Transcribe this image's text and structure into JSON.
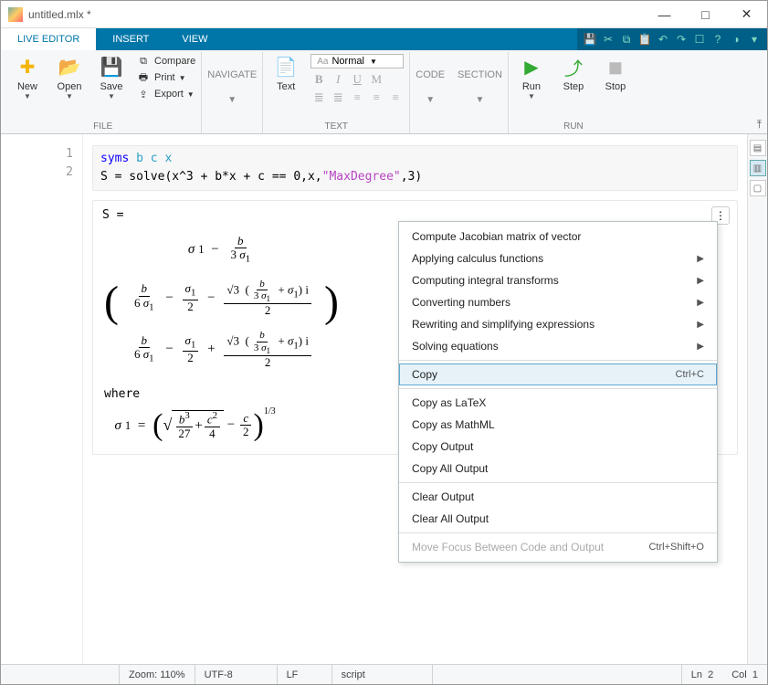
{
  "window": {
    "title": "untitled.mlx *"
  },
  "tabs": {
    "live_editor": "LIVE EDITOR",
    "insert": "INSERT",
    "view": "VIEW"
  },
  "ribbon": {
    "file": {
      "new": "New",
      "open": "Open",
      "save": "Save",
      "compare": "Compare",
      "print": "Print",
      "export": "Export",
      "label": "FILE"
    },
    "navigate": {
      "btn": "NAVIGATE"
    },
    "text": {
      "label": "TEXT",
      "btn": "Text",
      "style": "Normal"
    },
    "code": {
      "code": "CODE",
      "section": "SECTION"
    },
    "run": {
      "run": "Run",
      "step": "Step",
      "stop": "Stop",
      "label": "RUN"
    }
  },
  "lines": {
    "l1": "1",
    "l2": "2"
  },
  "code": {
    "kw": "syms",
    "vars": "b c x",
    "line2a": "S = solve(x^3 + b*x + c == 0,x,",
    "line2s": "\"MaxDegree\"",
    "line2b": ",3)"
  },
  "output": {
    "header": "S =",
    "where": "where"
  },
  "menu": {
    "jacobian": "Compute Jacobian matrix of vector",
    "calculus": "Applying calculus functions",
    "integral": "Computing integral transforms",
    "convert": "Converting numbers",
    "rewrite": "Rewriting and simplifying expressions",
    "solving": "Solving equations",
    "copy": "Copy",
    "copy_sc": "Ctrl+C",
    "copy_latex": "Copy as LaTeX",
    "copy_mathml": "Copy as MathML",
    "copy_output": "Copy Output",
    "copy_all_output": "Copy All Output",
    "clear_output": "Clear Output",
    "clear_all_output": "Clear All Output",
    "move_focus": "Move Focus Between Code and Output",
    "move_focus_sc": "Ctrl+Shift+O"
  },
  "status": {
    "zoom": "Zoom: 110%",
    "enc": "UTF-8",
    "eol": "LF",
    "type": "script",
    "ln": "Ln",
    "lnv": "2",
    "col": "Col",
    "colv": "1"
  }
}
